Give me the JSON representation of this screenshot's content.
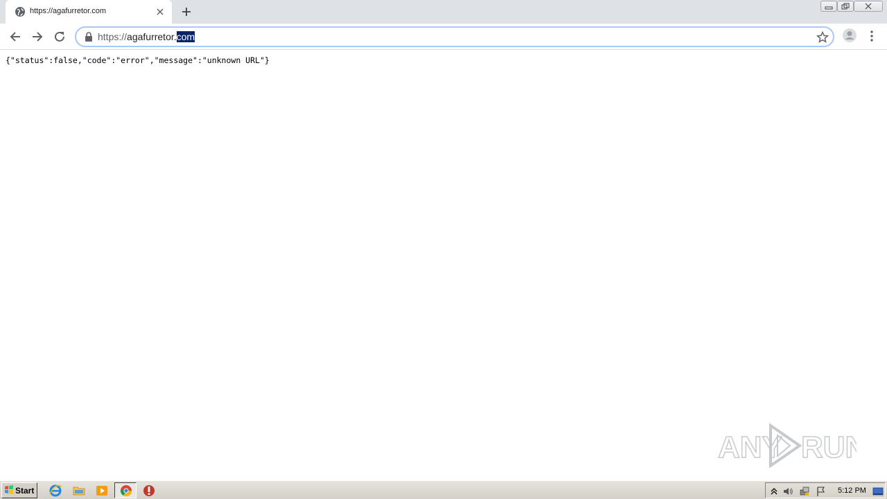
{
  "tab": {
    "title": "https://agafurretor.com",
    "favicon": "globe-icon"
  },
  "address_bar": {
    "scheme": "https://",
    "host_unselected": "agafurretor.",
    "host_selected": "com"
  },
  "page": {
    "body_text": "{\"status\":false,\"code\":\"error\",\"message\":\"unknown URL\"}"
  },
  "watermark": {
    "text": "ANY RUN"
  },
  "taskbar": {
    "start_label": "Start",
    "pinned": [
      "internet-explorer-icon",
      "folder-icon",
      "media-player-icon",
      "chrome-icon",
      "stop-icon"
    ],
    "clock": "5:12 PM"
  },
  "colors": {
    "tabstrip": "#dee1e6",
    "selection": "#0a246a",
    "taskbar": "#d4d0c8"
  }
}
